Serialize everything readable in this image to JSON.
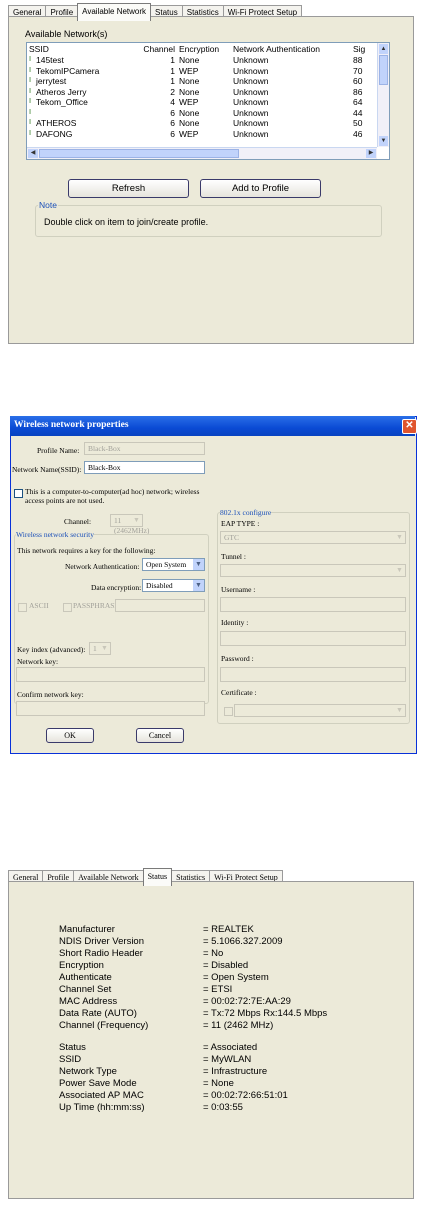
{
  "panel1": {
    "tabs": [
      "General",
      "Profile",
      "Available Network",
      "Status",
      "Statistics",
      "Wi-Fi Protect Setup"
    ],
    "active_tab": "Available Network",
    "section_title": "Available Network(s)",
    "columns": [
      "SSID",
      "Channel",
      "Encryption",
      "Network Authentication",
      "Sig"
    ],
    "rows": [
      {
        "ssid": "145test",
        "channel": "1",
        "encryption": "None",
        "auth": "Unknown",
        "signal": "88"
      },
      {
        "ssid": "TekomIPCamera",
        "channel": "1",
        "encryption": "WEP",
        "auth": "Unknown",
        "signal": "70"
      },
      {
        "ssid": "jerrytest",
        "channel": "1",
        "encryption": "None",
        "auth": "Unknown",
        "signal": "60"
      },
      {
        "ssid": "Atheros Jerry",
        "channel": "2",
        "encryption": "None",
        "auth": "Unknown",
        "signal": "86"
      },
      {
        "ssid": "Tekom_Office",
        "channel": "4",
        "encryption": "WEP",
        "auth": "Unknown",
        "signal": "64"
      },
      {
        "ssid": "",
        "channel": "6",
        "encryption": "None",
        "auth": "Unknown",
        "signal": "44"
      },
      {
        "ssid": "ATHEROS",
        "channel": "6",
        "encryption": "None",
        "auth": "Unknown",
        "signal": "50"
      },
      {
        "ssid": "DAFONG",
        "channel": "6",
        "encryption": "WEP",
        "auth": "Unknown",
        "signal": "46"
      }
    ],
    "refresh_label": "Refresh",
    "add_profile_label": "Add to Profile",
    "note_title": "Note",
    "note_text": "Double click on item to join/create profile."
  },
  "panel2": {
    "title": "Wireless network properties",
    "close_glyph": "✕",
    "profile_name_label": "Profile Name:",
    "profile_name_value": "Black-Box",
    "network_name_label": "Network Name(SSID):",
    "network_name_value": "Black-Box",
    "adhoc_text_1": "This is a computer-to-computer(ad hoc) network; wireless",
    "adhoc_text_2": "access points are not used.",
    "channel_label": "Channel:",
    "channel_value": "11 (2462MHz)",
    "security_group_title": "Wireless network security",
    "security_intro": "This network requires a key for the following:",
    "auth_label": "Network Authentication:",
    "auth_value": "Open System",
    "encryption_label": "Data encryption:",
    "encryption_value": "Disabled",
    "ascii_label": "ASCII",
    "passphrase_label": "PASSPHRASE",
    "key_index_label": "Key index (advanced):",
    "key_index_value": "1",
    "network_key_label": "Network key:",
    "confirm_key_label": "Confirm network key:",
    "dot1x_title": "802.1x configure",
    "eap_label": "EAP TYPE :",
    "eap_value": "GTC",
    "tunnel_label": "Tunnel :",
    "username_label": "Username :",
    "identity_label": "Identity :",
    "password_label": "Password :",
    "certificate_label": "Certificate :",
    "ok_label": "OK",
    "cancel_label": "Cancel"
  },
  "panel3": {
    "tabs": [
      "General",
      "Profile",
      "Available Network",
      "Status",
      "Statistics",
      "Wi-Fi Protect Setup"
    ],
    "active_tab": "Status",
    "rows_a": [
      {
        "label": "Manufacturer",
        "value": "= REALTEK"
      },
      {
        "label": "NDIS Driver Version",
        "value": "= 5.1066.327.2009"
      },
      {
        "label": "Short Radio Header",
        "value": "= No"
      },
      {
        "label": "Encryption",
        "value": "= Disabled"
      },
      {
        "label": "Authenticate",
        "value": "= Open System"
      },
      {
        "label": "Channel Set",
        "value": "= ETSI"
      },
      {
        "label": "MAC Address",
        "value": "= 00:02:72:7E:AA:29"
      },
      {
        "label": "Data Rate (AUTO)",
        "value": "= Tx:72 Mbps Rx:144.5 Mbps"
      },
      {
        "label": "Channel (Frequency)",
        "value": "= 11 (2462 MHz)"
      }
    ],
    "rows_b": [
      {
        "label": "Status",
        "value": "= Associated"
      },
      {
        "label": "SSID",
        "value": "= MyWLAN"
      },
      {
        "label": "Network Type",
        "value": "= Infrastructure"
      },
      {
        "label": "Power Save Mode",
        "value": "= None"
      },
      {
        "label": "Associated AP MAC",
        "value": "= 00:02:72:66:51:01"
      },
      {
        "label": "Up Time (hh:mm:ss)",
        "value": "= 0:03:55"
      }
    ]
  },
  "colors": {
    "panel_bg": "#ecead9",
    "titlebar": "#0a4ad4",
    "group_title": "#1a4fb8",
    "close": "#e0552e"
  }
}
